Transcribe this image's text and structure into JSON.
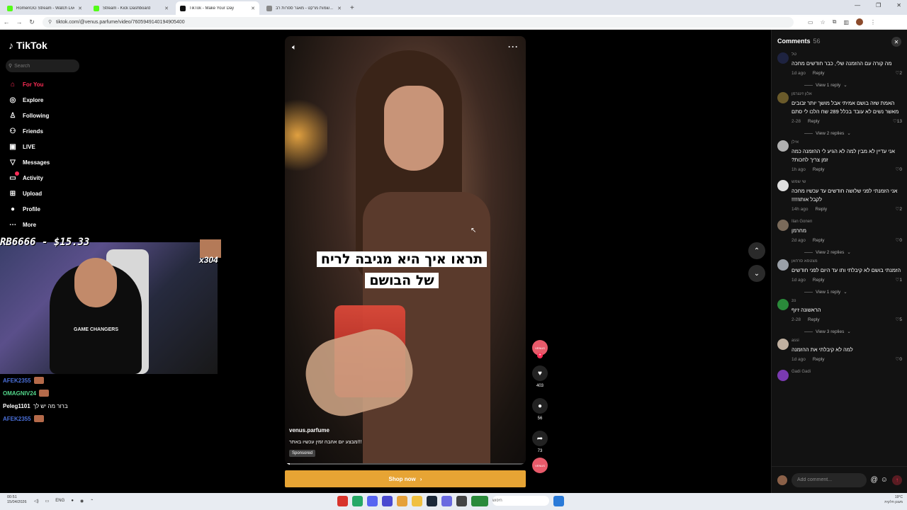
{
  "browser": {
    "tabs": [
      {
        "label": "RomenGG Stream - Watch Live -",
        "color": "#53fc18",
        "active": false
      },
      {
        "label": "Stream - Kick Dashboard",
        "color": "#53fc18",
        "active": false
      },
      {
        "label": "TikTok - Make Your Day",
        "color": "#111111",
        "active": true
      },
      {
        "label": "שמות מרקט - מאגר ספרות רב...",
        "color": "#888888",
        "active": false
      }
    ],
    "url": "tiktok.com/@venus.parfume/video/7605949140194905400"
  },
  "sidebar": {
    "logo": "TikTok",
    "search_placeholder": "Search",
    "items": [
      {
        "label": "For You",
        "icon": "home-icon",
        "glyph": "⌂"
      },
      {
        "label": "Explore",
        "icon": "compass-icon",
        "glyph": "◎"
      },
      {
        "label": "Following",
        "icon": "following-icon",
        "glyph": "♙"
      },
      {
        "label": "Friends",
        "icon": "friends-icon",
        "glyph": "⚇"
      },
      {
        "label": "LIVE",
        "icon": "live-icon",
        "glyph": "▣"
      },
      {
        "label": "Messages",
        "icon": "messages-icon",
        "glyph": "▽"
      },
      {
        "label": "Activity",
        "icon": "activity-icon",
        "glyph": "▭"
      },
      {
        "label": "Upload",
        "icon": "upload-icon",
        "glyph": "⊞"
      },
      {
        "label": "Profile",
        "icon": "profile-icon",
        "glyph": "●"
      },
      {
        "label": "More",
        "icon": "more-icon",
        "glyph": "⋯"
      }
    ],
    "active_color": "#fe2c55"
  },
  "stream": {
    "donation": "RB6666 - $15.33",
    "multiplier": "x304",
    "shirt_text": "GAME CHANGERS",
    "chat": [
      {
        "user": "AFEK2355",
        "message": "",
        "color": "#4a6fd8"
      },
      {
        "user": "OMAGNIV24",
        "message": "",
        "color": "#53d68a"
      },
      {
        "user": "Peleg1101",
        "message": "ברור מה יש לך",
        "color": "#ffffff"
      },
      {
        "user": "AFEK2355",
        "message": "",
        "color": "#4a6fd8"
      }
    ]
  },
  "video": {
    "caption": "תראו איך היא מגיבה לריח של הבושם",
    "author": "venus.parfume",
    "description": "!!!מבצע יום אהבה זמין עכשיו באתר",
    "sponsored": "Sponsored",
    "progress": 0.02,
    "cta": "Shop now",
    "rail": {
      "brand": "VENUS",
      "likes": "403",
      "comments": "56",
      "shares": "73"
    }
  },
  "comments": {
    "title": "Comments",
    "count": "56",
    "input_placeholder": "Add comment...",
    "items": [
      {
        "user": "טל",
        "text": "מה קורה עם ההזמנה שלי, כבר חודשים מחכה",
        "time": "1d ago",
        "reply": "Reply",
        "likes": "2",
        "replies": "View 1 reply",
        "avatar": "#1e2340"
      },
      {
        "user": "אלון זינגרמן",
        "text": "האמת שזה בושם אמיתי אבל מושך יותר זבובים מאשר נשים לא עובד בכלל 289 שח הלכו לי סתם",
        "time": "2-28",
        "reply": "Reply",
        "likes": "13",
        "replies": "View 2 replies",
        "avatar": "#6a5a2a"
      },
      {
        "user": "אילן",
        "text": "אני עדיין לא מבין למה לא הגיע לי ההזמנה כמה זמן צריך לחכות?",
        "time": "1h ago",
        "reply": "Reply",
        "likes": "0",
        "replies": "",
        "avatar": "#b0b0b0"
      },
      {
        "user": "שי שמש",
        "text": "אני הזמנתי לפני שלושה חודשים עד עכשיו מחכה לקבל אותו!!!!!",
        "time": "14h ago",
        "reply": "Reply",
        "likes": "2",
        "replies": "",
        "avatar": "#e0e0e0"
      },
      {
        "user": "Ilan Gonen",
        "text": "מחרמן",
        "time": "2d ago",
        "reply": "Reply",
        "likes": "0",
        "replies": "View 2 replies",
        "avatar": "#7a6a5a"
      },
      {
        "user": "מצטפא סרחאן",
        "text": "הזמנתי בושם לא קיבלתי ותו עד היום לפני חודשים",
        "time": "1d ago",
        "reply": "Reply",
        "likes": "1",
        "replies": "View 1 reply",
        "avatar": "#9aa0a8"
      },
      {
        "user": "zo",
        "text": "הראשונה זיוף",
        "time": "2-28",
        "reply": "Reply",
        "likes": "5",
        "replies": "View 3 replies",
        "avatar": "#2a8a3a"
      },
      {
        "user": "assi",
        "text": "למה לא קיבלתי את ההזמנה",
        "time": "1d ago",
        "reply": "Reply",
        "likes": "0",
        "replies": "",
        "avatar": "#c0b0a0"
      },
      {
        "user": "Gadi Gadi",
        "text": "",
        "time": "",
        "reply": "",
        "likes": "",
        "replies": "",
        "avatar": "#7a3ab0"
      }
    ]
  },
  "taskbar": {
    "time": "00:51",
    "date": "15/04/2026",
    "lang": "ENG",
    "search_placeholder": "חיפוש",
    "weather": "19°C",
    "weather_desc": "מעונן חלקית"
  }
}
